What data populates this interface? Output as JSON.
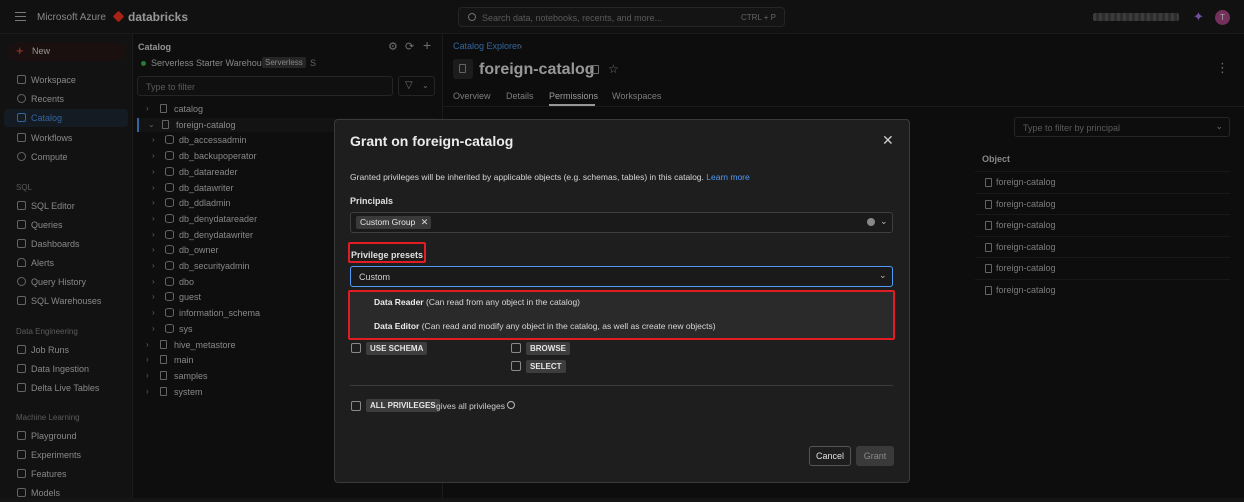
{
  "topbar": {
    "brand": "Microsoft Azure",
    "product": "databricks",
    "search_placeholder": "Search data, notebooks, recents, and more...",
    "search_shortcut": "CTRL + P",
    "user_initial": "T"
  },
  "sidebar": {
    "new_label": "New",
    "items": [
      "Workspace",
      "Recents",
      "Catalog",
      "Workflows",
      "Compute"
    ],
    "sql_section": "SQL",
    "sql_items": [
      "SQL Editor",
      "Queries",
      "Dashboards",
      "Alerts",
      "Query History",
      "SQL Warehouses"
    ],
    "de_section": "Data Engineering",
    "de_items": [
      "Job Runs",
      "Data Ingestion",
      "Delta Live Tables"
    ],
    "ml_section": "Machine Learning",
    "ml_items": [
      "Playground",
      "Experiments",
      "Features",
      "Models"
    ]
  },
  "catalog_panel": {
    "title": "Catalog",
    "warehouse": "Serverless Starter Warehouse",
    "warehouse_badge": "Serverless",
    "warehouse_size": "S",
    "filter_placeholder": "Type to filter",
    "tree": [
      "catalog",
      "foreign-catalog",
      "db_accessadmin",
      "db_backupoperator",
      "db_datareader",
      "db_datawriter",
      "db_ddladmin",
      "db_denydatareader",
      "db_denydatawriter",
      "db_owner",
      "db_securityadmin",
      "dbo",
      "guest",
      "information_schema",
      "sys",
      "hive_metastore",
      "main",
      "samples",
      "system"
    ]
  },
  "main": {
    "breadcrumb": "Catalog Explorer",
    "title": "foreign-catalog",
    "tabs": [
      "Overview",
      "Details",
      "Permissions",
      "Workspaces"
    ],
    "principal_filter_placeholder": "Type to filter by principal",
    "object_header": "Object",
    "object_rows": [
      "foreign-catalog",
      "foreign-catalog",
      "foreign-catalog",
      "foreign-catalog",
      "foreign-catalog",
      "foreign-catalog"
    ]
  },
  "modal": {
    "title": "Grant on foreign-catalog",
    "info": "Granted privileges will be inherited by applicable objects (e.g. schemas, tables) in this catalog.",
    "learn_more": "Learn more",
    "principals_label": "Principals",
    "principal_chip": "Custom Group",
    "presets_label": "Privilege presets",
    "preset_value": "Custom",
    "options": [
      {
        "name": "Data Reader",
        "desc": "(Can read from any object in the catalog)"
      },
      {
        "name": "Data Editor",
        "desc": "(Can read and modify any object in the catalog, as well as create new objects)"
      }
    ],
    "priv_use_schema": "USE SCHEMA",
    "priv_browse": "BROWSE",
    "priv_select": "SELECT",
    "priv_all": "ALL PRIVILEGES",
    "priv_all_note": "gives all privileges",
    "cancel_label": "Cancel",
    "grant_label": "Grant"
  },
  "colors": {
    "accent": "#4f9bf5",
    "highlight": "#e11d24",
    "brand": "#ff3621"
  }
}
